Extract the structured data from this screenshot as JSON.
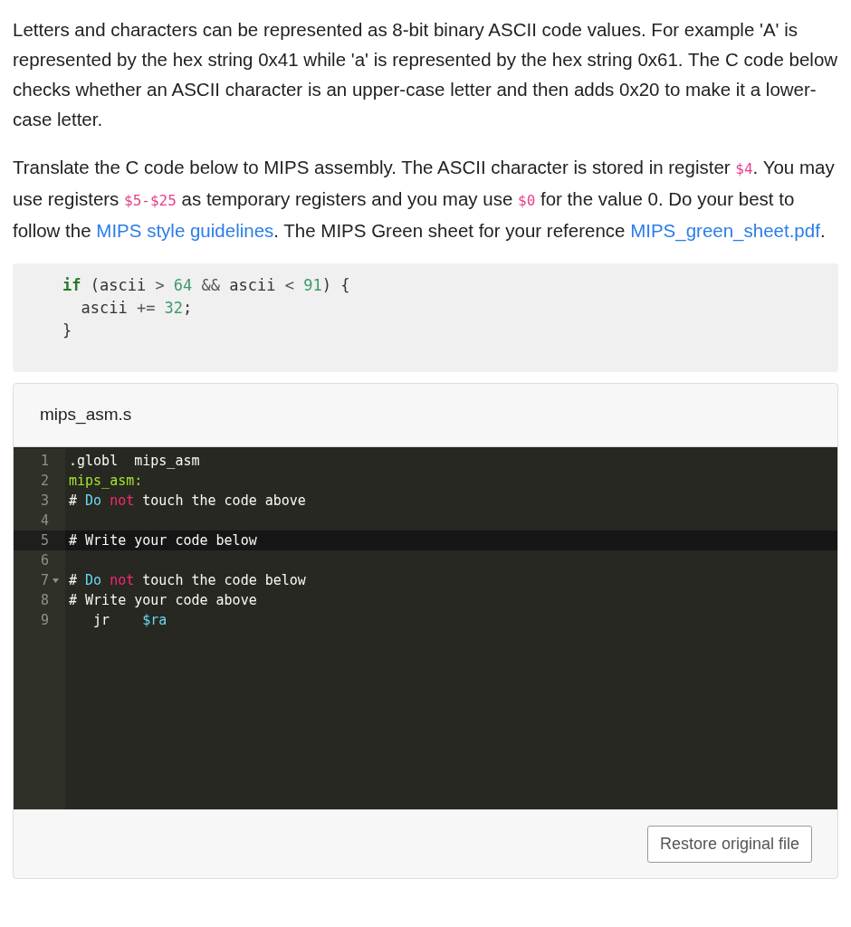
{
  "paragraphs": [
    [
      {
        "kind": "text",
        "text": "Letters and characters can be represented as 8-bit binary ASCII code values. For example 'A' is represented by the hex string 0x41 while 'a' is represented by the hex string 0x61. The C code below checks whether an ASCII character is an upper-case letter and then adds 0x20 to make it a lower-case letter."
      }
    ],
    [
      {
        "kind": "text",
        "text": "Translate the C code below to MIPS assembly. The ASCII character is stored in register "
      },
      {
        "kind": "code",
        "text": "$4"
      },
      {
        "kind": "text",
        "text": ". You may use registers "
      },
      {
        "kind": "code",
        "text": "$5-$25"
      },
      {
        "kind": "text",
        "text": " as temporary registers and you may use "
      },
      {
        "kind": "code",
        "text": "$0"
      },
      {
        "kind": "text",
        "text": " for the value 0. Do your best to follow the "
      },
      {
        "kind": "link",
        "text": "MIPS style guidelines"
      },
      {
        "kind": "text",
        "text": ". The MIPS Green sheet for your reference "
      },
      {
        "kind": "link",
        "text": "MIPS_green_sheet.pdf"
      },
      {
        "kind": "text",
        "text": "."
      }
    ]
  ],
  "c_code": [
    [
      {
        "kind": "keyword",
        "text": "if"
      },
      {
        "kind": "plain",
        "text": " (ascii "
      },
      {
        "kind": "op",
        "text": "> "
      },
      {
        "kind": "number",
        "text": "64"
      },
      {
        "kind": "op",
        "text": " && "
      },
      {
        "kind": "plain",
        "text": "ascii "
      },
      {
        "kind": "op",
        "text": "< "
      },
      {
        "kind": "number",
        "text": "91"
      },
      {
        "kind": "plain",
        "text": ") {"
      }
    ],
    [
      {
        "kind": "plain",
        "text": "  ascii "
      },
      {
        "kind": "op",
        "text": "+= "
      },
      {
        "kind": "number",
        "text": "32"
      },
      {
        "kind": "plain",
        "text": ";"
      }
    ],
    [
      {
        "kind": "plain",
        "text": "}"
      }
    ]
  ],
  "editor": {
    "filename": "mips_asm.s",
    "lines": [
      {
        "number": "1",
        "active": false,
        "foldable": false,
        "tokens": [
          {
            "kind": "plain",
            "text": ".globl  mips_asm"
          }
        ]
      },
      {
        "number": "2",
        "active": false,
        "foldable": false,
        "tokens": [
          {
            "kind": "label",
            "text": "mips_asm:"
          }
        ]
      },
      {
        "number": "3",
        "active": false,
        "foldable": false,
        "tokens": [
          {
            "kind": "plain",
            "text": "# "
          },
          {
            "kind": "blue",
            "text": "Do"
          },
          {
            "kind": "pink",
            "text": " not"
          },
          {
            "kind": "plain",
            "text": " touch the code above"
          }
        ]
      },
      {
        "number": "4",
        "active": false,
        "foldable": false
      },
      {
        "number": "5",
        "active": true,
        "foldable": false,
        "tokens": [
          {
            "kind": "plain",
            "text": "# Write your code below"
          }
        ]
      },
      {
        "number": "6",
        "active": false,
        "foldable": false
      },
      {
        "number": "7",
        "active": false,
        "foldable": true,
        "tokens": [
          {
            "kind": "plain",
            "text": "# "
          },
          {
            "kind": "blue",
            "text": "Do"
          },
          {
            "kind": "pink",
            "text": " not"
          },
          {
            "kind": "plain",
            "text": " touch the code below"
          }
        ]
      },
      {
        "number": "8",
        "active": false,
        "foldable": false,
        "tokens": [
          {
            "kind": "plain",
            "text": "# Write your code above"
          }
        ]
      },
      {
        "number": "9",
        "active": false,
        "foldable": false,
        "tokens": [
          {
            "kind": "plain",
            "text": "   jr    "
          },
          {
            "kind": "blue",
            "text": "$ra"
          }
        ]
      }
    ],
    "button": "Restore original file"
  }
}
